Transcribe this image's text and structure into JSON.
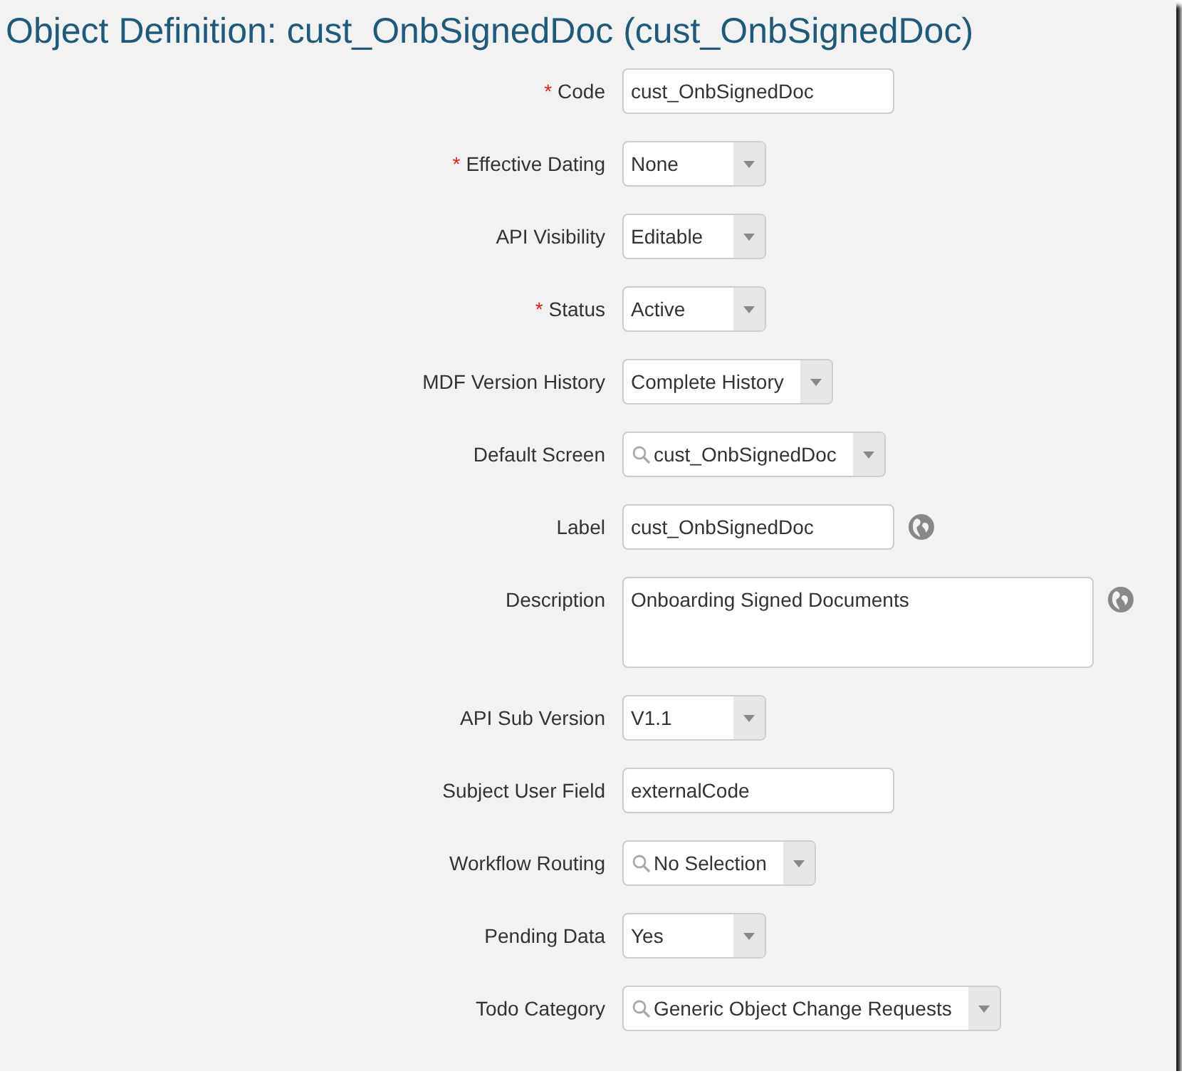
{
  "title": "Object Definition: cust_OnbSignedDoc (cust_OnbSignedDoc)",
  "required_marker": "*",
  "fields": [
    {
      "label": "Code",
      "required": true,
      "kind": "text",
      "value": "cust_OnbSignedDoc",
      "translatable": false
    },
    {
      "label": "Effective Dating",
      "required": true,
      "kind": "select",
      "value": "None",
      "translatable": false
    },
    {
      "label": "API Visibility",
      "required": false,
      "kind": "select",
      "value": "Editable",
      "translatable": false
    },
    {
      "label": "Status",
      "required": true,
      "kind": "select",
      "value": "Active",
      "translatable": false
    },
    {
      "label": "MDF Version History",
      "required": false,
      "kind": "select",
      "value": "Complete History",
      "translatable": false
    },
    {
      "label": "Default Screen",
      "required": false,
      "kind": "combo",
      "value": "cust_OnbSignedDoc",
      "translatable": false
    },
    {
      "label": "Label",
      "required": false,
      "kind": "text",
      "value": "cust_OnbSignedDoc",
      "translatable": true
    },
    {
      "label": "Description",
      "required": false,
      "kind": "textarea",
      "value": "Onboarding Signed Documents",
      "translatable": true
    },
    {
      "label": "API Sub Version",
      "required": false,
      "kind": "select",
      "value": "V1.1",
      "translatable": false
    },
    {
      "label": "Subject User Field",
      "required": false,
      "kind": "text",
      "value": "externalCode",
      "translatable": false
    },
    {
      "label": "Workflow Routing",
      "required": false,
      "kind": "combo",
      "value": "No Selection",
      "translatable": false
    },
    {
      "label": "Pending Data",
      "required": false,
      "kind": "select",
      "value": "Yes",
      "translatable": false
    },
    {
      "label": "Todo Category",
      "required": false,
      "kind": "combo",
      "value": "Generic Object Change Requests",
      "translatable": false
    }
  ]
}
